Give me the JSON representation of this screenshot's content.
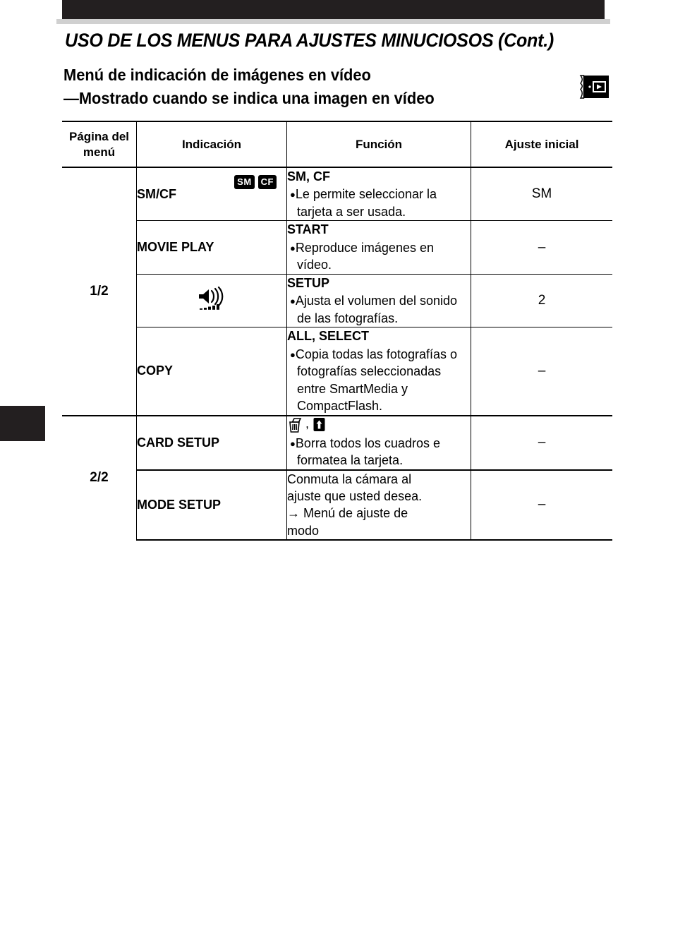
{
  "header": {
    "title": "USO DE LOS MENUS PARA AJUSTES MINUCIOSOS (Cont.)",
    "subtitle_line1": "Menú de indicación de imágenes en vídeo",
    "subtitle_line2": "—Mostrado cuando se indica una imagen en vídeo",
    "mode_icon_name": "movie-playback-mode-icon"
  },
  "table": {
    "columns": [
      "Página del menú",
      "Indicación",
      "Función",
      "Ajuste inicial"
    ],
    "column_header_page_l1": "Página del",
    "column_header_page_l2": "menú",
    "rows": [
      {
        "page": "1/2",
        "indication": "SM/CF",
        "badges": [
          "SM",
          "CF"
        ],
        "function_head": "SM, CF",
        "function_body": "Le permite seleccionar la tarjeta a ser usada.",
        "initial": "SM"
      },
      {
        "page": "",
        "indication": "MOVIE PLAY",
        "function_head": "START",
        "function_body": "Reproduce imágenes en vídeo.",
        "initial": "–"
      },
      {
        "page": "",
        "indication": "",
        "indication_icon": "volume-speaker-icon",
        "function_head": "SETUP",
        "function_body": "Ajusta el volumen del sonido de las fotografías.",
        "initial": "2"
      },
      {
        "page": "",
        "indication": "COPY",
        "function_head": "ALL, SELECT",
        "function_body": "Copia todas las fotografías o fotografías seleccionadas entre SmartMedia y CompactFlash.",
        "initial": "–"
      },
      {
        "page": "2/2",
        "indication": "CARD SETUP",
        "function_icons": [
          "trash-can-icon",
          "card-format-icon"
        ],
        "function_icon_separator": ",",
        "function_body": "Borra todos los cuadros e formatea la tarjeta.",
        "initial": "–"
      },
      {
        "page": "",
        "indication": "MODE SETUP",
        "function_plain_1": "Conmuta la cámara al",
        "function_plain_2": "ajuste que usted desea.",
        "function_plain_3": "Menú de ajuste de",
        "function_plain_4": "modo",
        "function_arrow": "→",
        "initial": "–"
      }
    ]
  },
  "colors": {
    "ink": "#231f20",
    "rule": "#000000",
    "gray_bar": "#d0d0d0"
  }
}
